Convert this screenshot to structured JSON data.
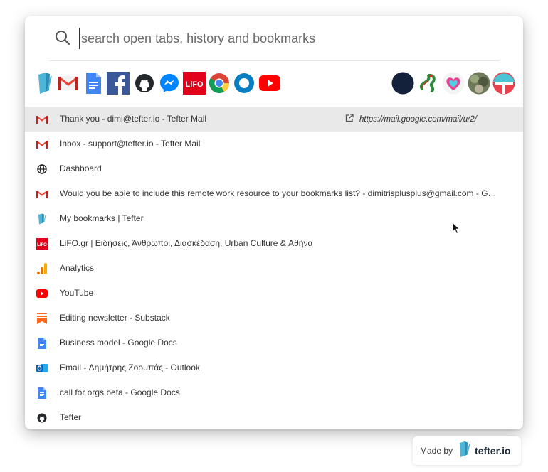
{
  "search": {
    "placeholder": "search open tabs, history and bookmarks",
    "value": ""
  },
  "quick_access": {
    "left": [
      "tefter-icon",
      "gmail-icon",
      "google-docs-icon",
      "facebook-icon",
      "github-icon",
      "messenger-icon",
      "lifo-icon",
      "chrome-icon",
      "circle-o-icon",
      "youtube-icon"
    ],
    "right": [
      "dark-circle-avatar",
      "snake-avatar",
      "heart-avatar",
      "photo-avatar",
      "red-t-avatar"
    ],
    "lifo_text": "LiFO"
  },
  "results": [
    {
      "icon": "gmail-icon",
      "title": "Thank you - dimi@tefter.io - Tefter Mail",
      "url": "https://mail.google.com/mail/u/2/",
      "active": true
    },
    {
      "icon": "gmail-icon",
      "title": "Inbox - support@tefter.io - Tefter Mail"
    },
    {
      "icon": "globe-icon",
      "title": "Dashboard"
    },
    {
      "icon": "gmail-icon",
      "title": "Would you be able to include this remote work resource to your bookmarks list? - dimitrisplusplus@gmail.com - G…"
    },
    {
      "icon": "tefter-icon",
      "title": "My bookmarks | Tefter"
    },
    {
      "icon": "lifo-icon",
      "title": "LiFO.gr | Ειδήσεις, Άνθρωποι, Διασκέδαση, Urban Culture & Αθήνα"
    },
    {
      "icon": "analytics-icon",
      "title": "Analytics"
    },
    {
      "icon": "youtube-icon",
      "title": "YouTube"
    },
    {
      "icon": "substack-icon",
      "title": "Editing newsletter - Substack"
    },
    {
      "icon": "google-docs-icon",
      "title": "Business model - Google Docs"
    },
    {
      "icon": "outlook-icon",
      "title": "Email - Δημήτρης Ζορμπάς - Outlook"
    },
    {
      "icon": "google-docs-icon",
      "title": "call for orgs beta - Google Docs"
    },
    {
      "icon": "github-icon",
      "title": "Tefter"
    }
  ],
  "footer": {
    "made_by": "Made by",
    "brand": "tefter.io"
  },
  "colors": {
    "active_row": "#e9e9e9",
    "gmail_red": "#ea4335",
    "lifo_red": "#e3001b",
    "youtube_red": "#ff0000",
    "brand_dark": "#1d2a38"
  }
}
